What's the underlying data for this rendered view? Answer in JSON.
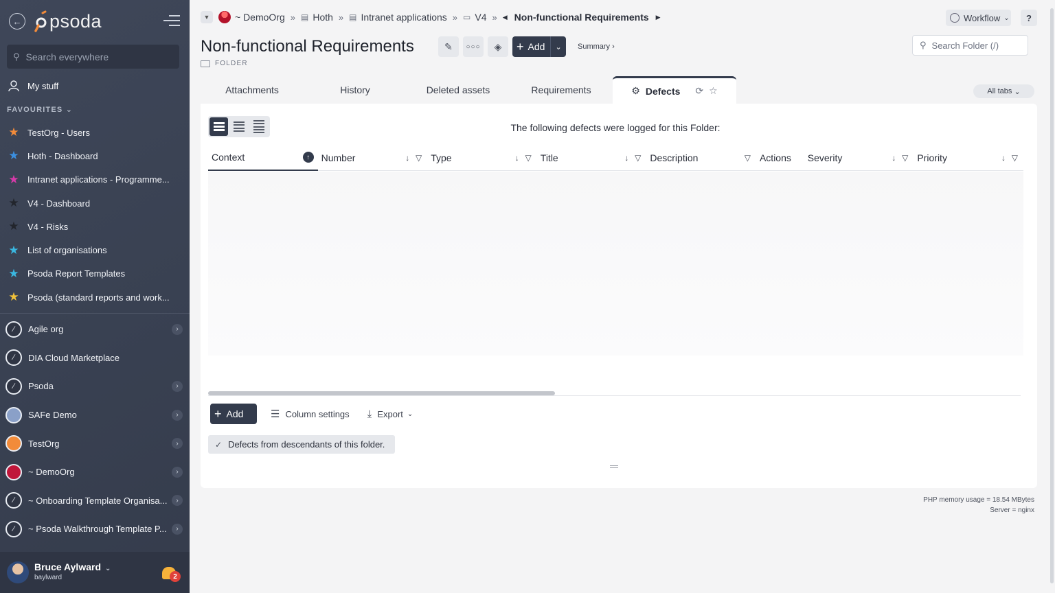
{
  "sidebar": {
    "logo_text": "psoda",
    "search_placeholder": "Search everywhere",
    "my_stuff": "My stuff",
    "favourites_title": "FAVOURITES",
    "favourites": [
      {
        "label": "TestOrg - Users",
        "color": "#f28b3a"
      },
      {
        "label": "Hoth - Dashboard",
        "color": "#3b8fe0"
      },
      {
        "label": "Intranet applications - Programme...",
        "color": "#d63aa9"
      },
      {
        "label": "V4 - Dashboard",
        "color": "#22252c"
      },
      {
        "label": "V4 - Risks",
        "color": "#22252c"
      },
      {
        "label": "List of organisations",
        "color": "#3ab7e0"
      },
      {
        "label": "Psoda Report Templates",
        "color": "#3ab7e0"
      },
      {
        "label": "Psoda (standard reports and work...",
        "color": "#f2c23a"
      }
    ],
    "orgs": [
      {
        "label": "Agile org",
        "chevron": true
      },
      {
        "label": "DIA Cloud Marketplace",
        "chevron": false
      },
      {
        "label": "Psoda",
        "chevron": true
      },
      {
        "label": "SAFe Demo",
        "chevron": true
      },
      {
        "label": "TestOrg",
        "chevron": true
      },
      {
        "label": "~ DemoOrg",
        "chevron": true
      },
      {
        "label": "~ Onboarding Template Organisa...",
        "chevron": true
      },
      {
        "label": "~ Psoda Walkthrough Template P...",
        "chevron": true
      }
    ],
    "user": {
      "name": "Bruce Aylward",
      "login": "baylward",
      "notifications": "2"
    }
  },
  "breadcrumb": {
    "items": [
      "~ DemoOrg",
      "Hoth",
      "Intranet applications",
      "V4"
    ],
    "current": "Non-functional Requirements"
  },
  "header": {
    "title": "Non-functional Requirements",
    "type_label": "FOLDER",
    "add_label": "Add",
    "summary_label": "Summary ›",
    "workflow_label": "Workflow",
    "help_label": "?",
    "search_placeholder": "Search Folder (/)"
  },
  "tabs": {
    "items": [
      "Attachments",
      "History",
      "Deleted assets",
      "Requirements"
    ],
    "active": "Defects",
    "all_tabs": "All tabs"
  },
  "panel": {
    "message": "The following defects were logged for this Folder:",
    "columns": [
      "Context",
      "Number",
      "Type",
      "Title",
      "Description",
      "Actions",
      "Severity",
      "Priority"
    ],
    "add_label": "Add",
    "column_settings": "Column settings",
    "export_label": "Export",
    "descendants_label": "Defects from descendants of this folder."
  },
  "footer": {
    "memory": "PHP memory usage = 18.54 MBytes",
    "server": "Server = nginx"
  }
}
